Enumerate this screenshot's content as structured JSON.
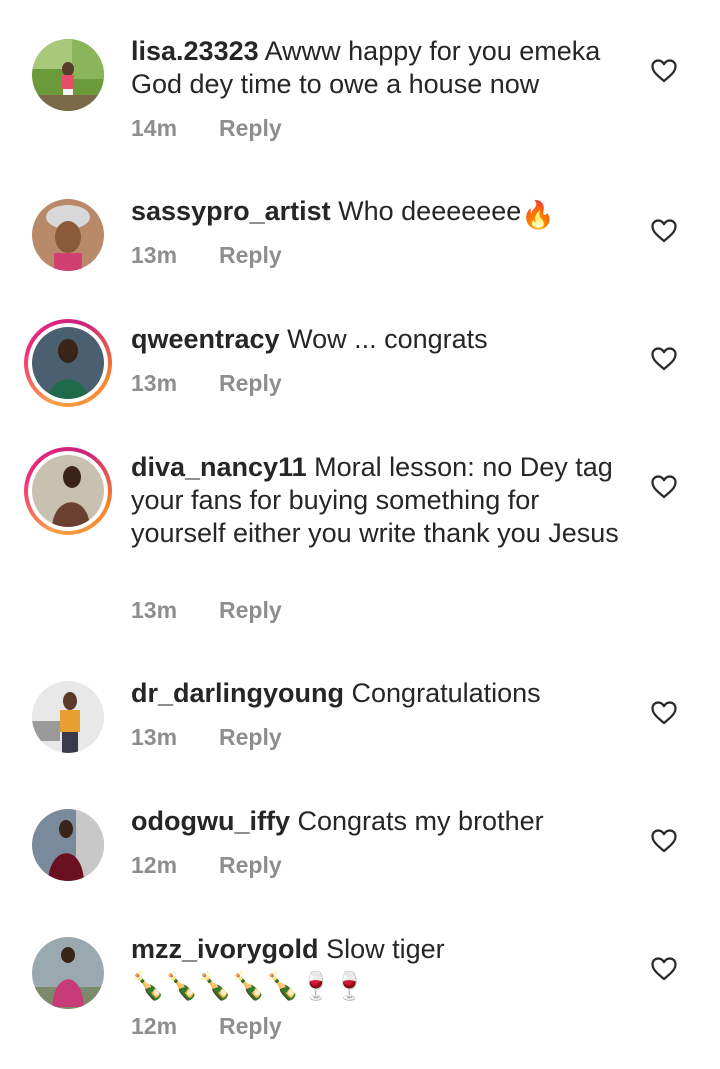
{
  "comments": [
    {
      "username": "lisa.23323",
      "text": "Awww happy for you emeka God dey time to owe a house now",
      "time": "14m",
      "reply": "Reply",
      "has_story": false,
      "emojis": ""
    },
    {
      "username": "sassypro_artist",
      "text": "Who deeeeeee",
      "time": "13m",
      "reply": "Reply",
      "has_story": false,
      "emojis": "🔥"
    },
    {
      "username": "qweentracy",
      "text": "Wow ... congrats",
      "time": "13m",
      "reply": "Reply",
      "has_story": true,
      "emojis": ""
    },
    {
      "username": "diva_nancy11",
      "text": "Moral lesson: no Dey tag your fans for buying something for yourself either you write thank you Jesus",
      "time": "13m",
      "reply": "Reply",
      "has_story": true,
      "emojis": ""
    },
    {
      "username": "dr_darlingyoung",
      "text": "Congratulations",
      "time": "13m",
      "reply": "Reply",
      "has_story": false,
      "emojis": ""
    },
    {
      "username": "odogwu_iffy",
      "text": "Congrats my brother",
      "time": "12m",
      "reply": "Reply",
      "has_story": false,
      "emojis": ""
    },
    {
      "username": "mzz_ivorygold",
      "text": "Slow tiger",
      "time": "12m",
      "reply": "Reply",
      "has_story": false,
      "emojis": "🍾🍾🍾🍾🍾🍷🍷"
    }
  ],
  "icons": {
    "like": "heart-outline-icon"
  },
  "colors": {
    "text": "#262626",
    "muted": "#8e8e8e",
    "story_ring_start": "#f9a14a",
    "story_ring_end": "#c9207f"
  }
}
